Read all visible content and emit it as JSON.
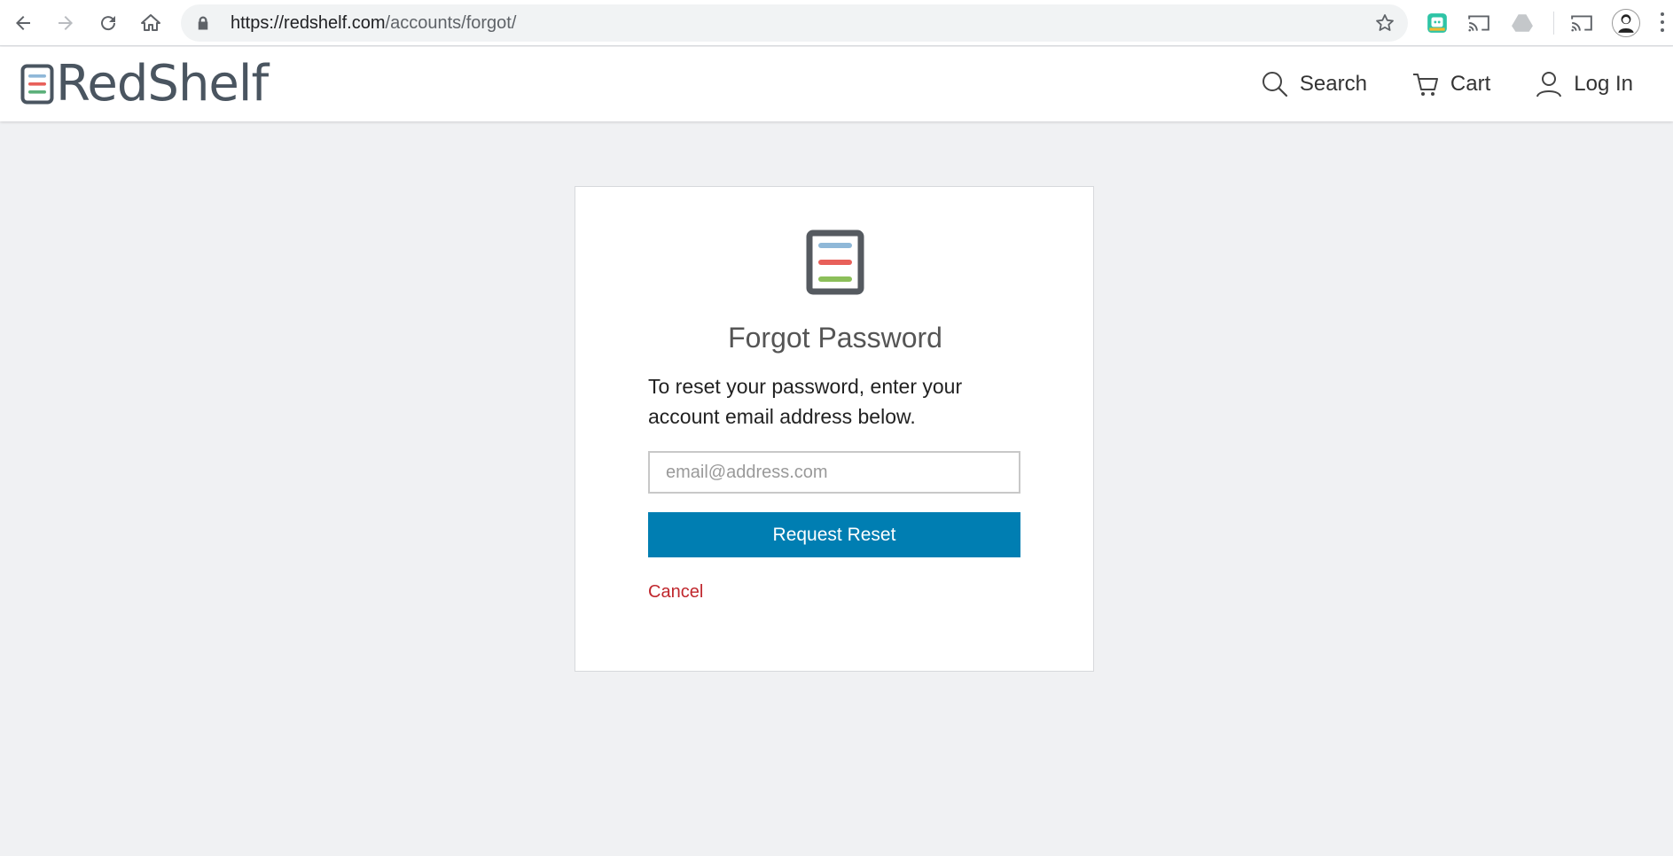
{
  "browser": {
    "url_host": "https://redshelf.com",
    "url_path": "/accounts/forgot/",
    "icons": [
      "back-icon",
      "forward-icon",
      "reload-icon",
      "home-icon",
      "lock-icon",
      "star-icon",
      "extension-icon",
      "cast-icon",
      "drive-icon",
      "cast-icon",
      "profile-avatar",
      "menu-icon"
    ]
  },
  "header": {
    "logo_text": "RedShelf",
    "nav": {
      "search": "Search",
      "cart": "Cart",
      "login": "Log In"
    }
  },
  "card": {
    "title": "Forgot Password",
    "description": "To reset your password, enter your account email address below.",
    "email_placeholder": "email@address.com",
    "email_value": "",
    "submit_label": "Request Reset",
    "cancel_label": "Cancel"
  },
  "colors": {
    "primary_button": "#007eb2",
    "cancel_link": "#c0272d",
    "logo_blue": "#8fb8d8",
    "logo_red": "#e8605a",
    "logo_green": "#8cbf5a",
    "logo_frame": "#555a60",
    "page_background": "#f0f1f3"
  }
}
